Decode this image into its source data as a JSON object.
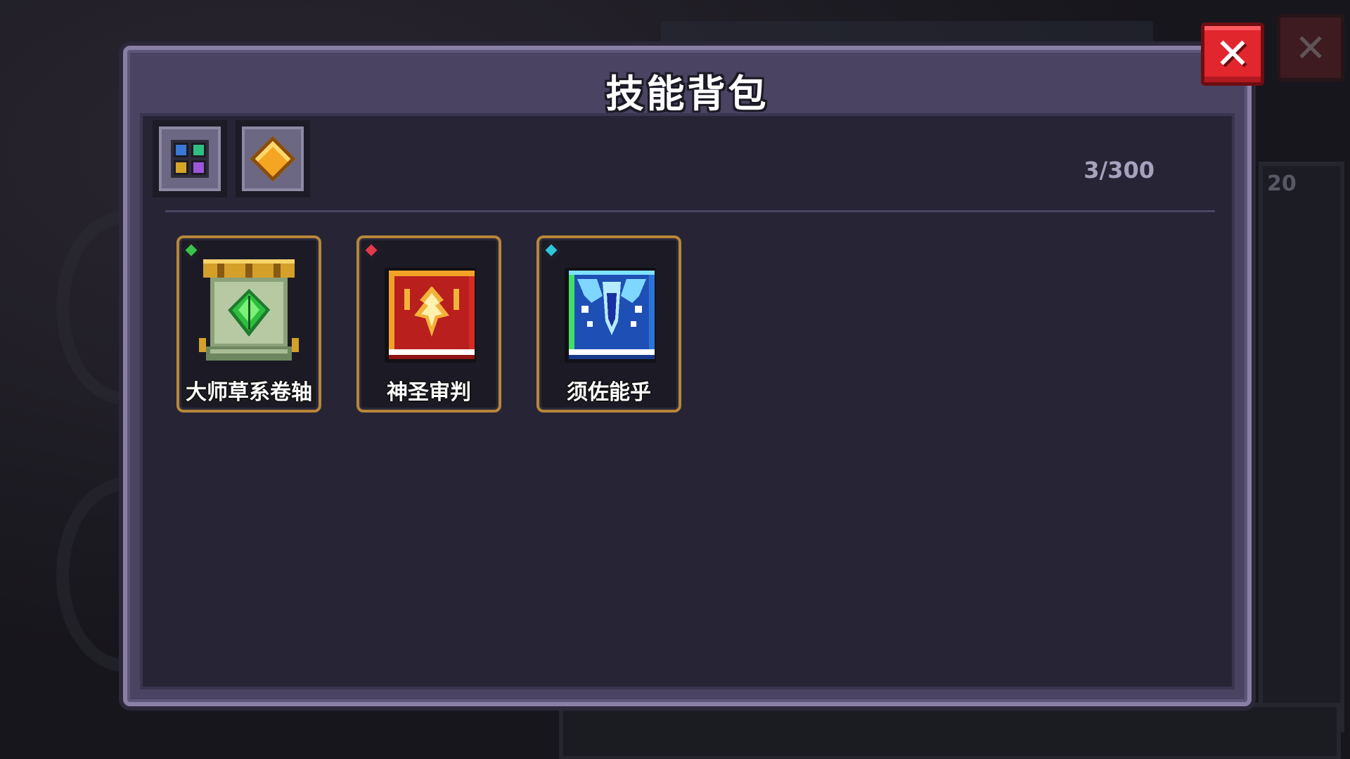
{
  "panel": {
    "title": "技能背包",
    "count": "3/300"
  },
  "tabs": [
    {
      "icon": "grid-icon"
    },
    {
      "icon": "diamond-icon"
    }
  ],
  "skills": [
    {
      "label": "大师草系卷轴",
      "gem_color": "#38c447",
      "icon": "green-leaf-scroll-icon"
    },
    {
      "label": "神圣审判",
      "gem_color": "#e23a4a",
      "icon": "holy-judgement-book-icon"
    },
    {
      "label": "须佐能乎",
      "gem_color": "#2ec7d8",
      "icon": "susanoo-book-icon"
    }
  ],
  "close_button": {
    "icon": "close-icon"
  },
  "background": {
    "count_label": "20"
  }
}
